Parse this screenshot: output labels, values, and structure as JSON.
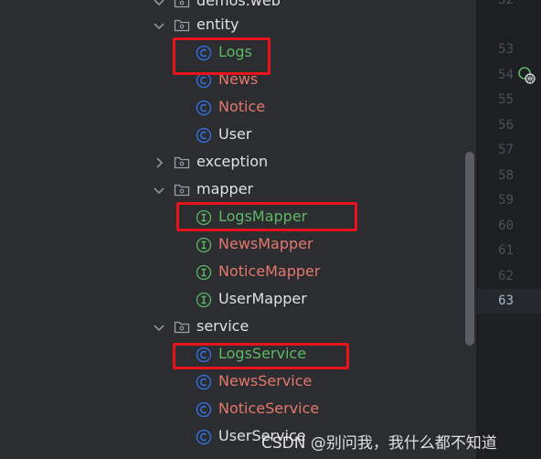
{
  "tree": {
    "top_partial": "demos.web",
    "items": [
      {
        "label": "entity",
        "kind": "package",
        "expanded": true
      },
      {
        "label": "Logs",
        "kind": "class",
        "color": "#5fb865"
      },
      {
        "label": "News",
        "kind": "class",
        "color": "#e5786d"
      },
      {
        "label": "Notice",
        "kind": "class",
        "color": "#e5786d"
      },
      {
        "label": "User",
        "kind": "class",
        "color": "#dfe1e5"
      },
      {
        "label": "exception",
        "kind": "package",
        "expanded": false
      },
      {
        "label": "mapper",
        "kind": "package",
        "expanded": true
      },
      {
        "label": "LogsMapper",
        "kind": "interface",
        "color": "#5fb865"
      },
      {
        "label": "NewsMapper",
        "kind": "interface",
        "color": "#e5786d"
      },
      {
        "label": "NoticeMapper",
        "kind": "interface",
        "color": "#e5786d"
      },
      {
        "label": "UserMapper",
        "kind": "interface",
        "color": "#dfe1e5"
      },
      {
        "label": "service",
        "kind": "package",
        "expanded": true
      },
      {
        "label": "LogsService",
        "kind": "class",
        "color": "#5fb865"
      },
      {
        "label": "NewsService",
        "kind": "class",
        "color": "#e5786d"
      },
      {
        "label": "NoticeService",
        "kind": "class",
        "color": "#e5786d"
      },
      {
        "label": "UserService",
        "kind": "class",
        "color": "#dfe1e5"
      }
    ]
  },
  "gutter": {
    "line_numbers": [
      "52",
      "53",
      "54",
      "55",
      "56",
      "57",
      "58",
      "59",
      "60",
      "61",
      "62",
      "63"
    ],
    "current_line": "63"
  },
  "watermark": "CSDN @别问我，我什么都不知道",
  "colors": {
    "added": "#5fb865",
    "modified": "#e5786d",
    "highlight": "#e8141b",
    "class_icon": "#3574f0",
    "interface_icon": "#5fb865"
  }
}
